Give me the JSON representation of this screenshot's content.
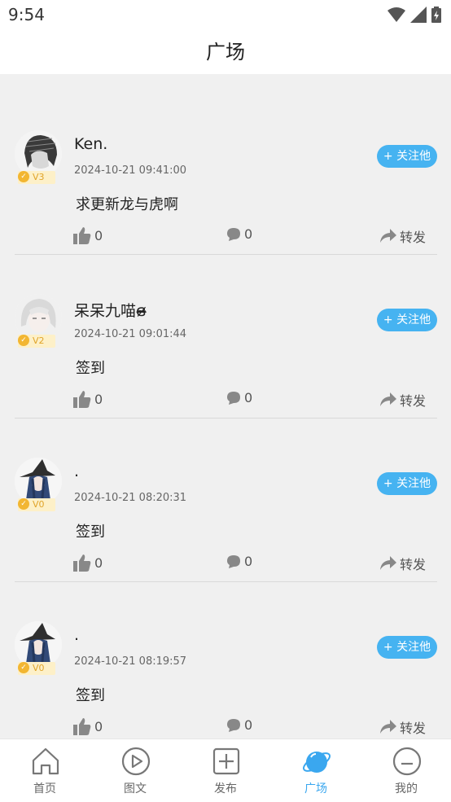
{
  "status_bar": {
    "time": "9:54"
  },
  "header": {
    "title": "广场"
  },
  "follow_label": "+ 关注他",
  "share_label": "转发",
  "posts": [
    {
      "username": "Ken.",
      "level": "V3",
      "time": "2024-10-21 09:41:00",
      "content": "求更新龙与虎啊",
      "likes": "0",
      "comments": "0"
    },
    {
      "username": "呆呆九喵ɞ̴̶̷",
      "level": "V2",
      "time": "2024-10-21 09:01:44",
      "content": "签到",
      "likes": "0",
      "comments": "0"
    },
    {
      "username": ".",
      "level": "V0",
      "time": "2024-10-21 08:20:31",
      "content": "签到",
      "likes": "0",
      "comments": "0"
    },
    {
      "username": ".",
      "level": "V0",
      "time": "2024-10-21 08:19:57",
      "content": "签到",
      "likes": "0",
      "comments": "0"
    }
  ],
  "tabs": [
    {
      "label": "首页",
      "icon": "home-icon",
      "active": false
    },
    {
      "label": "图文",
      "icon": "play-circle-icon",
      "active": false
    },
    {
      "label": "发布",
      "icon": "plus-square-icon",
      "active": false
    },
    {
      "label": "广场",
      "icon": "planet-icon",
      "active": true
    },
    {
      "label": "我的",
      "icon": "smile-face-icon",
      "active": false
    }
  ],
  "colors": {
    "accent": "#46b3f1",
    "active_tab": "#3aa7ef",
    "level_gold": "#f2b632"
  }
}
